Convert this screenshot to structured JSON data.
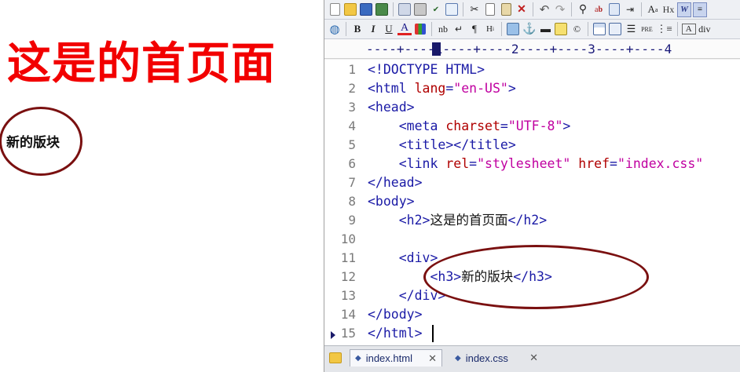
{
  "preview": {
    "heading": "这是的首页面",
    "block_heading": "新的版块"
  },
  "editor": {
    "ruler": "----+----1----+----2----+----3----+----4",
    "toolbar_row2_labels": {
      "bold": "B",
      "italic": "I",
      "underline": "U",
      "font_color": "A",
      "nbsp": "nb",
      "paragraph": "¶",
      "hx": "Hx",
      "pre": "PRE",
      "div": "div"
    },
    "code_lines": [
      {
        "n": "1",
        "parts": [
          [
            "t",
            "<!DOCTYPE HTML>"
          ]
        ]
      },
      {
        "n": "2",
        "parts": [
          [
            "t",
            "<html "
          ],
          [
            "a",
            "lang"
          ],
          [
            "t",
            "="
          ],
          [
            "s",
            "\"en-US\""
          ],
          [
            "t",
            ">"
          ]
        ]
      },
      {
        "n": "3",
        "parts": [
          [
            "t",
            "<head>"
          ]
        ]
      },
      {
        "n": "4",
        "parts": [
          [
            "x",
            "    "
          ],
          [
            "t",
            "<meta "
          ],
          [
            "a",
            "charset"
          ],
          [
            "t",
            "="
          ],
          [
            "s",
            "\"UTF-8\""
          ],
          [
            "t",
            ">"
          ]
        ]
      },
      {
        "n": "5",
        "parts": [
          [
            "x",
            "    "
          ],
          [
            "t",
            "<title></title>"
          ]
        ]
      },
      {
        "n": "6",
        "parts": [
          [
            "x",
            "    "
          ],
          [
            "t",
            "<link "
          ],
          [
            "a",
            "rel"
          ],
          [
            "t",
            "="
          ],
          [
            "s",
            "\"stylesheet\""
          ],
          [
            "t",
            " "
          ],
          [
            "a",
            "href"
          ],
          [
            "t",
            "="
          ],
          [
            "s",
            "\"index.css\""
          ]
        ]
      },
      {
        "n": "7",
        "parts": [
          [
            "t",
            "</head>"
          ]
        ]
      },
      {
        "n": "8",
        "parts": [
          [
            "t",
            "<body>"
          ]
        ]
      },
      {
        "n": "9",
        "parts": [
          [
            "x",
            "    "
          ],
          [
            "t",
            "<h2>"
          ],
          [
            "x",
            "这是的首页面"
          ],
          [
            "t",
            "</h2>"
          ]
        ]
      },
      {
        "n": "10",
        "parts": []
      },
      {
        "n": "11",
        "parts": [
          [
            "x",
            "    "
          ],
          [
            "t",
            "<div>"
          ]
        ]
      },
      {
        "n": "12",
        "parts": [
          [
            "x",
            "        "
          ],
          [
            "t",
            "<h3>"
          ],
          [
            "x",
            "新的版块"
          ],
          [
            "t",
            "</h3>"
          ]
        ]
      },
      {
        "n": "13",
        "parts": [
          [
            "x",
            "    "
          ],
          [
            "t",
            "</div>"
          ]
        ]
      },
      {
        "n": "14",
        "parts": [
          [
            "t",
            "</body>"
          ]
        ]
      },
      {
        "n": "15",
        "parts": [
          [
            "t",
            "</html>"
          ]
        ]
      }
    ],
    "tabs": [
      {
        "label": "index.html",
        "active": true
      },
      {
        "label": "index.css",
        "active": false
      }
    ],
    "colors": {
      "tag": "#1a1aa6",
      "attribute": "#b00000",
      "string": "#c000a0",
      "heading_red": "#f20000",
      "annotation": "#7a1010"
    }
  }
}
